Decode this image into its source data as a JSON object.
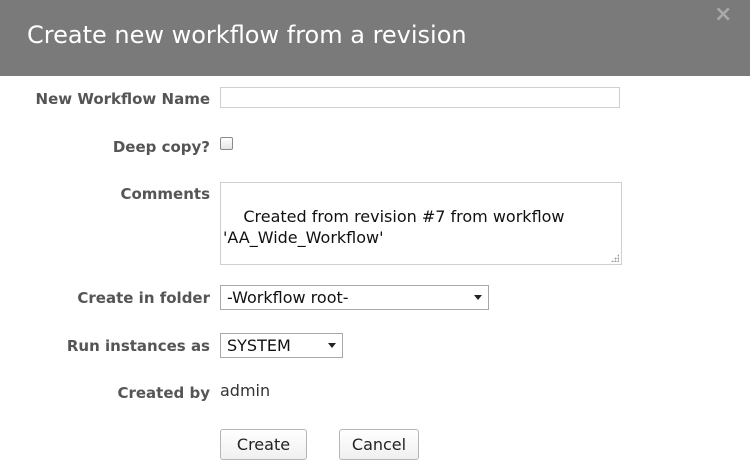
{
  "dialog": {
    "title": "Create new workflow from a revision",
    "close_label": "×"
  },
  "form": {
    "workflow_name": {
      "label": "New Workflow Name",
      "value": "",
      "placeholder": ""
    },
    "deep_copy": {
      "label": "Deep copy?",
      "checked": false
    },
    "comments": {
      "label": "Comments",
      "value": "Created from revision #7 from workflow 'AA_Wide_Workflow'"
    },
    "create_in_folder": {
      "label": "Create in folder",
      "selected": "-Workflow root-"
    },
    "run_instances_as": {
      "label": "Run instances as",
      "selected": "SYSTEM"
    },
    "created_by": {
      "label": "Created by",
      "value": "admin"
    }
  },
  "buttons": {
    "create_label": "Create",
    "cancel_label": "Cancel"
  },
  "colors": {
    "titlebar": "#7a7a7a",
    "label_text": "#555555"
  }
}
